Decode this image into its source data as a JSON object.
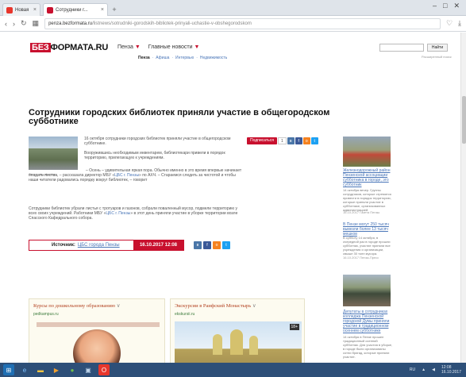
{
  "browser": {
    "tabs": [
      {
        "label": "Новая",
        "favicon_color": "#e8362c",
        "active": false
      },
      {
        "label": "Сотрудники г...",
        "favicon_color": "#c8102e",
        "active": true
      }
    ],
    "url": {
      "host": "penza.bezformata.ru",
      "path": "/listnews/sotrudniki-gorodskih-bibliotek-prinyali-uchastie-v-obshegorodskom"
    },
    "window_controls": [
      "–",
      "□",
      "✕"
    ]
  },
  "site": {
    "logo_red": "БЕЗ",
    "logo_black": "ФОРМАТА.RU",
    "city": "Пенза",
    "main_news": "Главные новости",
    "subnav": [
      "Пенза",
      "Афиша",
      "Интервью",
      "Недвижимость"
    ],
    "search_button": "Найти",
    "search_hint": "Расширенный поиск"
  },
  "article": {
    "title": "Сотрудники городских библиотек приняли участие в общегородском субботнике",
    "photo_caption": "Фото: penzabook.ru",
    "lead": "16 октября сотрудники городских библиотек приняли участие в общегородском субботнике.",
    "p2": "Вооружившись необходимым инвентарем, библиотекари привели в порядок территорию, прилегающую к учреждениям.",
    "p3_start": "– Осень – удивительная яркая пора. Обычно именно в это время впервые начинает опадать листва, – рассказала директор МБУ «",
    "p3_link1": "ЦБС г. Пензы",
    "p3_mid": "» по АХЧ. – Стараемся следить за чистотой и чтобы наши читатели радовались порядку вокруг библиотек, – говорит",
    "p4_start": "Сотрудники библиотек убрали листья с тротуаров и газонов, собрали поваленный мусор, подмели территорию у всех своих учреждений. Работники МБУ «",
    "p4_link": "ЦБС г. Пензы",
    "p4_end": "» в этот день приняли участие в уборке территории возле Спасского Кафедрального собора.",
    "share_plus": "Подписаться",
    "share_count": "1",
    "source_label": "Источник:",
    "source_value": "ЦБС города Пензы",
    "date": "16.10.2017 12:08"
  },
  "sidebar": [
    {
      "title": "Железнодорожный район Пензенской ассоциации субботника в городе, это субботник",
      "text": "14 октября вечер. Группы сотрудников, которые стремятся привести в порядок территорию, которые приняли участие в субботнике, организованных администрацией.",
      "date": "16.10.2017 Газета Пензы"
    },
    {
      "title": "В Пензе могут 250 тысяч вывезли более 13 тысяч мешков",
      "text": "В субботу 14 октября, в очередной раз в городе прошли субботник, участие приняли все учреждения и организации, свыше 30 тонн мусора.",
      "date": "16.10.2017 Пенза-Пресс"
    },
    {
      "title": "Депутаты в сотрудниках колледжа Пензенской городской Думы приняли участие в традиционном осеннем субботнике",
      "text": "14 октября в Пензе прошел традиционный осенний субботник. Для участия в уборке, в городе были организованы сотни бригад, которые приняли участие.",
      "date": "16.10.2017"
    }
  ],
  "ads": [
    {
      "title": "Курсы по дошкольному образованию",
      "domain": "pedkampus.ru",
      "badge": ""
    },
    {
      "title": "Экскурсии в Раифский Монастырь",
      "domain": "ekskursii.ru",
      "badge": "18+"
    }
  ],
  "taskbar": {
    "lang": "RU",
    "time": "12:08",
    "date": "16.10.2017"
  }
}
